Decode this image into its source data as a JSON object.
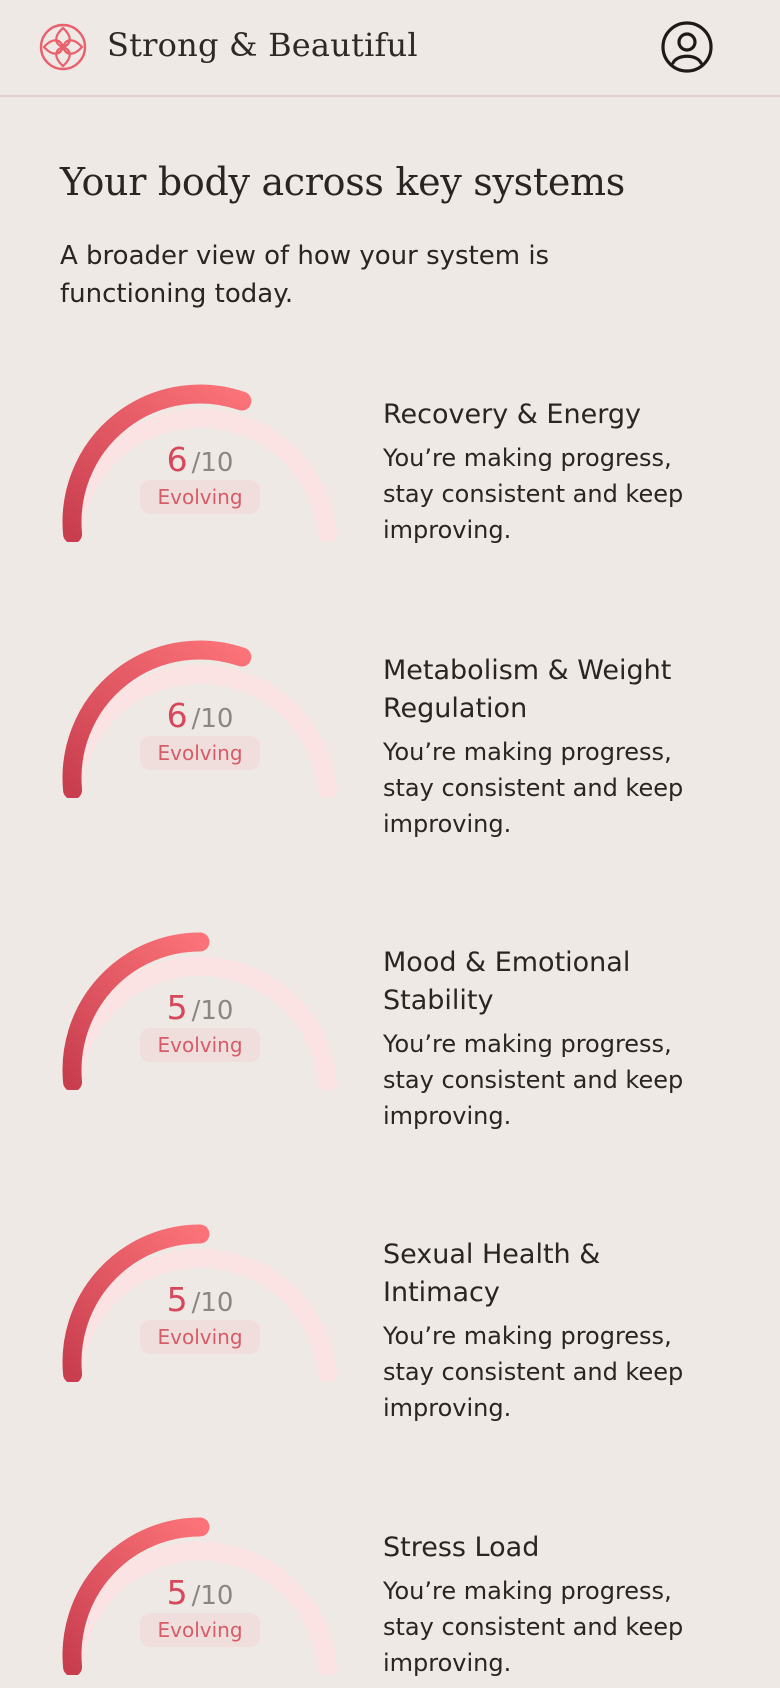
{
  "header": {
    "brand": "Strong & Beautiful",
    "logo_icon": "flower-icon",
    "profile_icon": "user-circle-icon"
  },
  "main": {
    "title": "Your body across key systems",
    "subtitle": "A broader view of how your system is functioning today."
  },
  "systems": [
    {
      "name": "Recovery & Energy",
      "score": "6",
      "max": "/10",
      "status": "Evolving",
      "description": "You’re making progress, stay consistent and keep improving."
    },
    {
      "name": "Metabolism & Weight Regulation",
      "score": "6",
      "max": "/10",
      "status": "Evolving",
      "description": "You’re making progress, stay consistent and keep improving."
    },
    {
      "name": "Mood & Emotional Stability",
      "score": "5",
      "max": "/10",
      "status": "Evolving",
      "description": "You’re making progress, stay consistent and keep improving."
    },
    {
      "name": "Sexual Health & Intimacy",
      "score": "5",
      "max": "/10",
      "status": "Evolving",
      "description": "You’re making progress, stay consistent and keep improving."
    },
    {
      "name": "Stress Load",
      "score": "5",
      "max": "/10",
      "status": "Evolving",
      "description": "You’re making progress, stay consistent and keep improving."
    }
  ],
  "colors": {
    "background": "#EEE9E5",
    "accent": "#D6485A",
    "gauge_track": "#FBE3E4",
    "badge_bg": "#F0DEDD"
  }
}
